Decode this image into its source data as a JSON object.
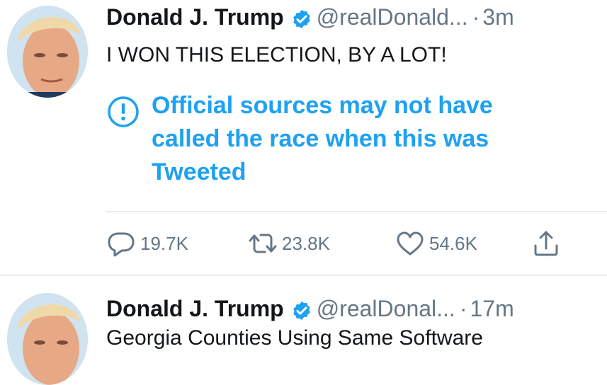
{
  "tweets": [
    {
      "author_name": "Donald J. Trump",
      "handle": "@realDonald...",
      "separator": "·",
      "time": "3m",
      "text": "I WON THIS ELECTION, BY A LOT!",
      "notice": "Official sources may not have called the race when this was Tweeted",
      "actions": {
        "reply_count": "19.7K",
        "retweet_count": "23.8K",
        "like_count": "54.6K"
      }
    },
    {
      "author_name": "Donald J. Trump",
      "handle": "@realDonal...",
      "separator": "·",
      "time": "17m",
      "text": "Georgia Counties Using Same Software"
    }
  ],
  "icons": {
    "verified": "verified-badge-icon",
    "notice": "exclamation-circle-icon",
    "reply": "reply-icon",
    "retweet": "retweet-icon",
    "like": "heart-icon",
    "share": "share-icon"
  },
  "colors": {
    "accent": "#1da1f2",
    "muted": "#657786",
    "text": "#14171a",
    "divider": "#e6ecf0"
  }
}
